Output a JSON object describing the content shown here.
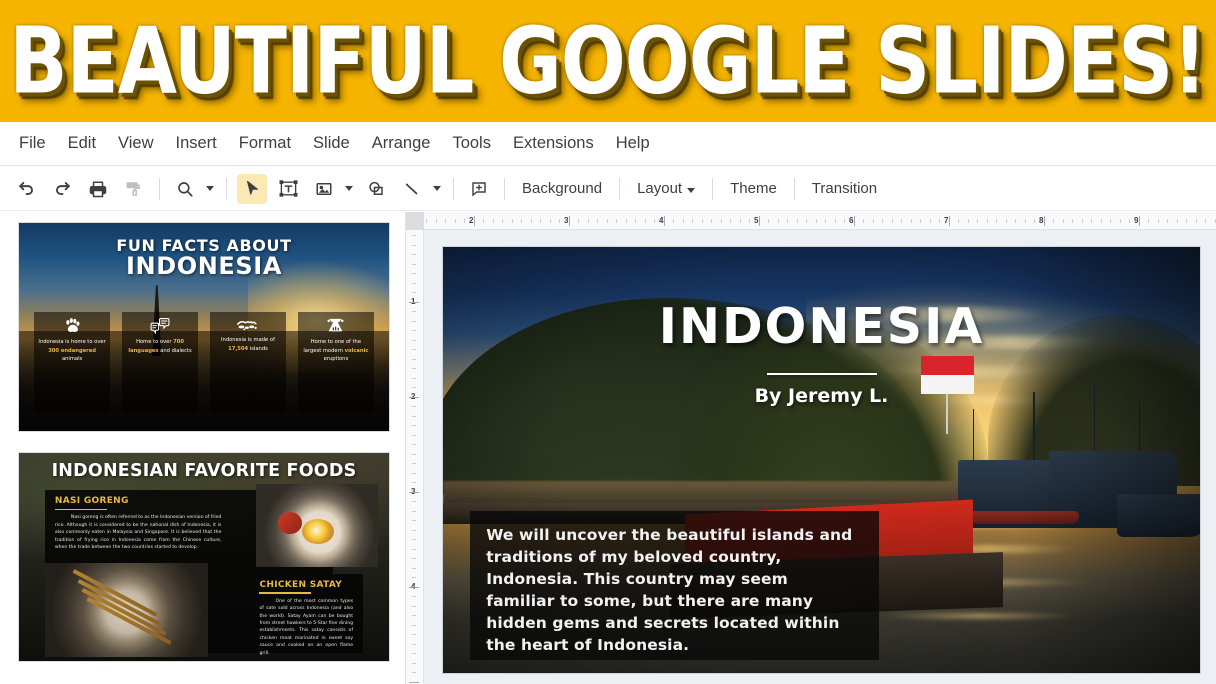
{
  "banner": {
    "text": "BEAUTIFUL GOOGLE SLIDES!",
    "bg_color": "#f5b400",
    "text_color": "#ffffff"
  },
  "menubar": {
    "items": [
      {
        "label": "File"
      },
      {
        "label": "Edit"
      },
      {
        "label": "View"
      },
      {
        "label": "Insert"
      },
      {
        "label": "Format"
      },
      {
        "label": "Slide"
      },
      {
        "label": "Arrange"
      },
      {
        "label": "Tools"
      },
      {
        "label": "Extensions"
      },
      {
        "label": "Help"
      }
    ]
  },
  "toolbar": {
    "icons": [
      {
        "name": "undo-icon",
        "title": "Undo"
      },
      {
        "name": "redo-icon",
        "title": "Redo"
      },
      {
        "name": "print-icon",
        "title": "Print"
      },
      {
        "name": "paint-format-icon",
        "title": "Paint format"
      },
      {
        "name": "zoom-icon",
        "title": "Zoom"
      },
      {
        "name": "select-icon",
        "title": "Select",
        "active": true
      },
      {
        "name": "text-box-icon",
        "title": "Text box"
      },
      {
        "name": "insert-image-icon",
        "title": "Insert image"
      },
      {
        "name": "shape-icon",
        "title": "Shape"
      },
      {
        "name": "line-icon",
        "title": "Line"
      },
      {
        "name": "comment-icon",
        "title": "Add comment"
      }
    ],
    "background_label": "Background",
    "layout_label": "Layout",
    "theme_label": "Theme",
    "transition_label": "Transition",
    "active_tool_color": "#fce8b2"
  },
  "rulers": {
    "horizontal_marks": [
      "2",
      "3",
      "4",
      "5",
      "6",
      "7",
      "8",
      "9"
    ],
    "vertical_marks": [
      "1",
      "2",
      "3",
      "4"
    ]
  },
  "filmstrip": {
    "slides": [
      {
        "name": "fun-facts-about-indonesia",
        "title_line1": "FUN FACTS ABOUT",
        "title_line2": "INDONESIA",
        "cards": [
          {
            "icon": "paw-icon",
            "text_before": "Indonesia is home to over ",
            "highlight": "300 endangered",
            "text_after": " animals"
          },
          {
            "icon": "speech-bubbles-icon",
            "text_before": "Home to over ",
            "highlight": "700 languages",
            "text_after": " and dialects"
          },
          {
            "icon": "archipelago-map-icon",
            "text_before": "Indonesia is made of ",
            "highlight": "17,504",
            "text_after": " islands"
          },
          {
            "icon": "volcano-icon",
            "text_before": "Home to one of the largest modern ",
            "highlight": "volcanic",
            "text_after": " eruptions"
          }
        ]
      },
      {
        "name": "indonesian-favorite-foods",
        "title": "INDONESIAN FAVORITE FOODS",
        "sections": [
          {
            "heading": "NASI GORENG",
            "body": "Nasi goreng is often referred to as the Indonesian version of fried rice. Although it is considered to be the national dish of Indonesia, it is also commonly eaten in Malaysia and Singapore. It is believed that the tradition of frying rice in Indonesia came from the Chinese culture, when the trade between the two countries started to develop."
          },
          {
            "heading": "CHICKEN SATAY",
            "body": "One of the most common types of sate sold across Indonesia (and also the world). Satay Ayam can be bought from street hawkers to 5-Star fine dining establishments. This satay consists of chicken meat marinated in sweet soy sauce and cooked on an open flame grill."
          }
        ]
      }
    ]
  },
  "current_slide": {
    "title": "INDONESIA",
    "subtitle": "By Jeremy L.",
    "body": "We will uncover the beautiful islands and traditions of my beloved country, Indonesia. This country may seem familiar to some, but there are many hidden gems and secrets located within the heart of Indonesia.",
    "background_description": "Sunset harbour with moored wooden boats, forested hill and Indonesian flag"
  }
}
